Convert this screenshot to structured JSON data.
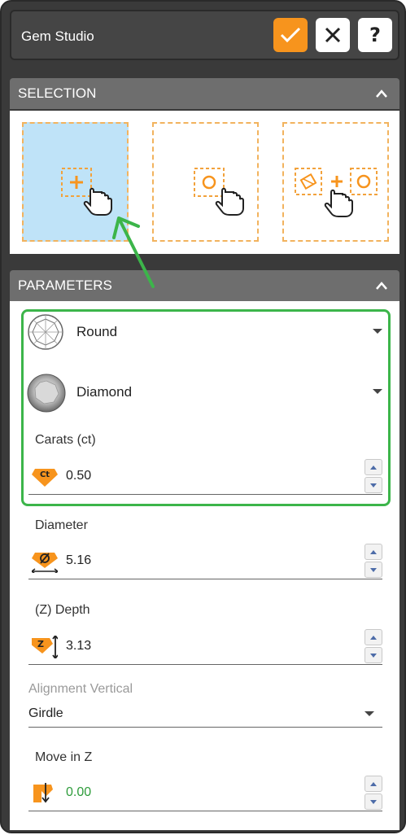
{
  "window": {
    "title": "Gem Studio"
  },
  "toolbar": {
    "ok_icon": "checkmark-icon",
    "cancel_icon": "close-icon",
    "help_label": "?"
  },
  "selection": {
    "header": "SELECTION",
    "options": [
      {
        "name": "add-point-option",
        "icon": "plus-hand-icon",
        "active": true
      },
      {
        "name": "circle-point-option",
        "icon": "circle-hand-icon",
        "active": false
      },
      {
        "name": "gem-plus-circle-option",
        "icon": "gem-plus-circle-hand-icon",
        "active": false
      }
    ]
  },
  "parameters": {
    "header": "PARAMETERS",
    "shape": "Round",
    "material": "Diamond",
    "carats": {
      "label": "Carats (ct)",
      "value": "0.50",
      "icon_text": "Ct"
    },
    "diameter": {
      "label": "Diameter",
      "value": "5.16"
    },
    "depth": {
      "label": "(Z) Depth",
      "value": "3.13",
      "icon_text": "Z"
    },
    "alignment": {
      "label": "Alignment Vertical",
      "value": "Girdle"
    },
    "move_z": {
      "label": "Move in Z",
      "value": "0.00"
    }
  },
  "colors": {
    "accent": "#f7941d",
    "highlight": "#3cb54a",
    "active_fill": "#bfe3f8"
  }
}
